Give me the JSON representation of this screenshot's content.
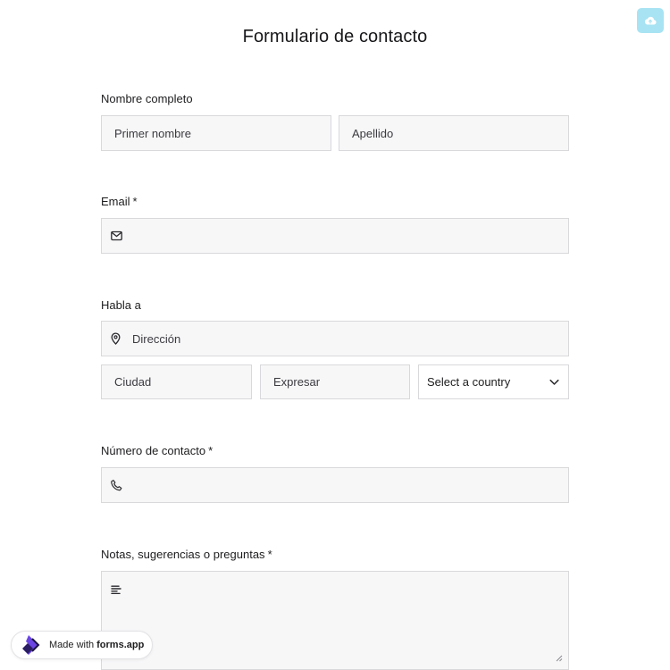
{
  "form": {
    "title": "Formulario de contacto",
    "full_name": {
      "label": "Nombre completo",
      "first_placeholder": "Primer nombre",
      "last_placeholder": "Apellido"
    },
    "email": {
      "label": "Email",
      "required_mark": "*",
      "icon": "mail-icon"
    },
    "address": {
      "label": "Habla a",
      "street_placeholder": "Dirección",
      "city_placeholder": "Ciudad",
      "state_placeholder": "Expresar",
      "country_selected": "Select a country",
      "icon": "map-pin-icon"
    },
    "phone": {
      "label": "Número de contacto",
      "required_mark": "*",
      "icon": "phone-icon"
    },
    "notes": {
      "label": "Notas, sugerencias o preguntas",
      "required_mark": "*",
      "icon": "text-lines-icon"
    }
  },
  "badge": {
    "prefix": "Made with",
    "brand": "forms.app"
  },
  "colors": {
    "accent_cloud": "#a8e3f3",
    "field_bg": "#f7f7f8",
    "field_border": "#d9d9dc",
    "brand_purple": "#6b46e5"
  }
}
